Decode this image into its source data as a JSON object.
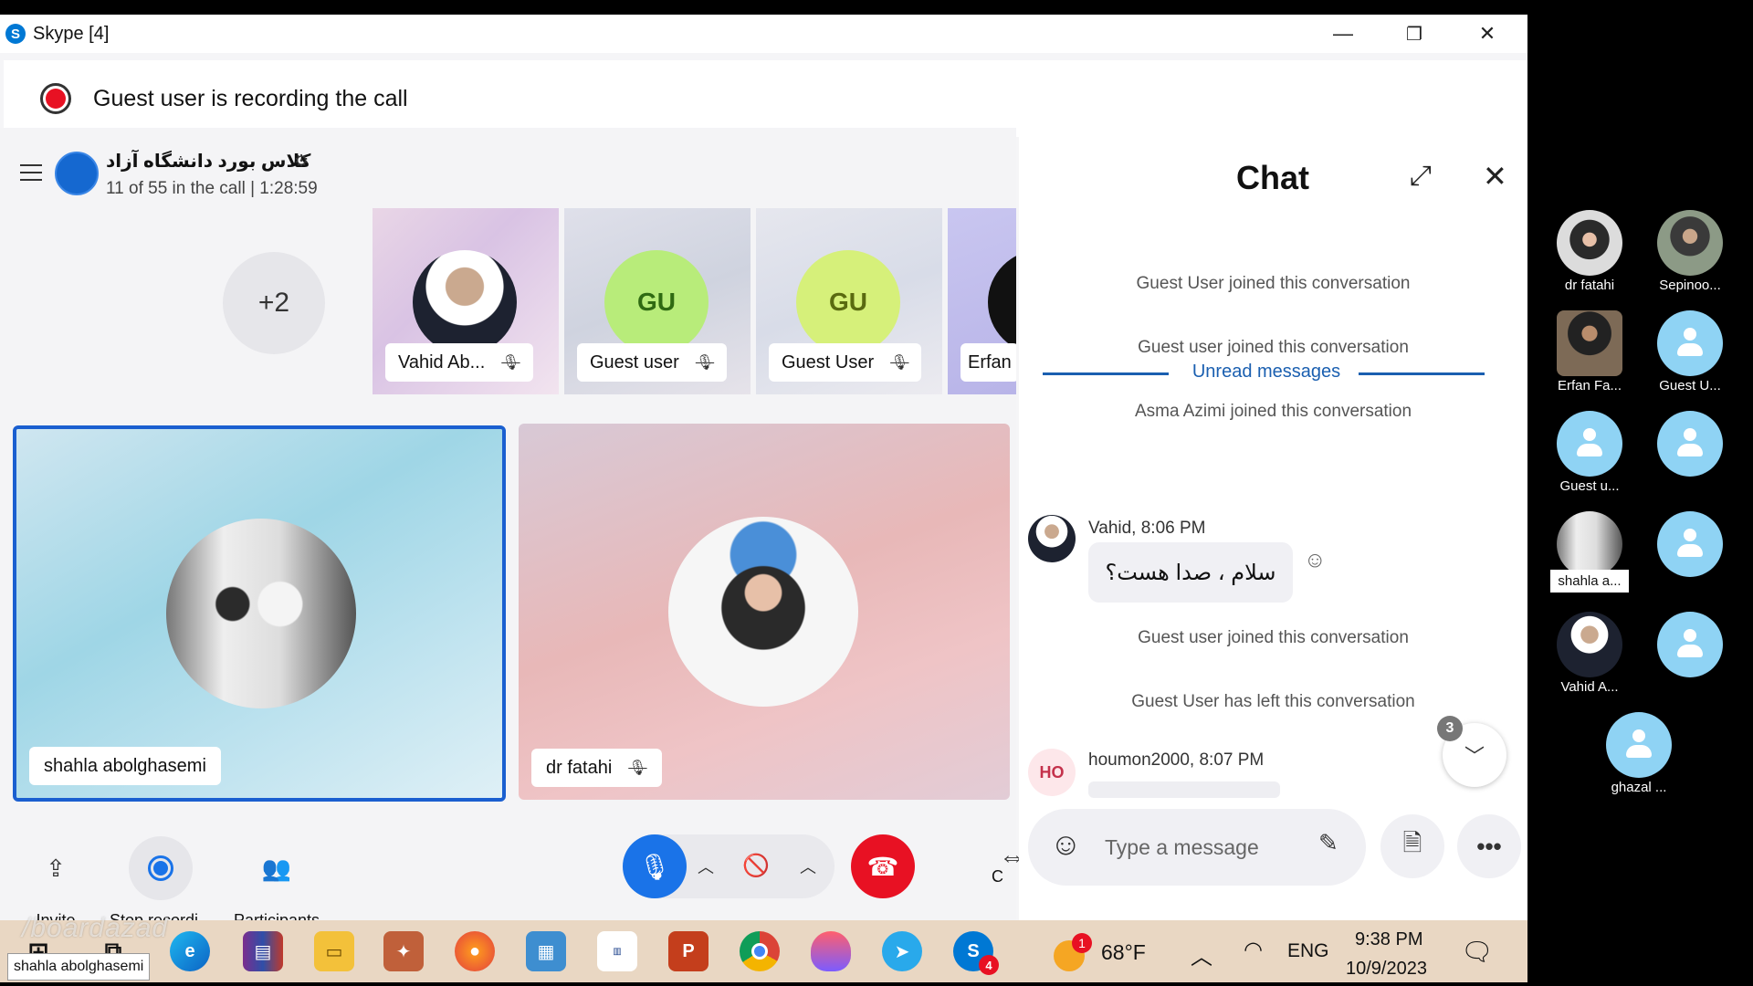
{
  "window": {
    "title": "Skype [4]",
    "app_logo": "S",
    "minimize_glyph": "—",
    "restore_glyph": "❐",
    "close_glyph": "✕"
  },
  "recording_banner": {
    "text": "Guest user is recording the call"
  },
  "call": {
    "group_name": "کلاس بورد دانشگاه آزاد",
    "status": "11 of 55 in the call | 1:28:59",
    "more_count": "+2",
    "participants_strip": [
      {
        "name": "Vahid Ab...",
        "initials": "",
        "muted": true
      },
      {
        "name": "Guest user",
        "initials": "GU",
        "muted": true
      },
      {
        "name": "Guest User",
        "initials": "GU",
        "muted": true
      },
      {
        "name": "Erfan",
        "initials": "",
        "muted": false
      }
    ],
    "main_tiles": [
      {
        "name": "shahla abolghasemi",
        "muted": false
      },
      {
        "name": "dr fatahi",
        "muted": true
      }
    ],
    "toolbar": {
      "invite_label": "Invite",
      "stop_recording_label": "Stop recordi...",
      "participants_label": "Participants",
      "partial_label": "C"
    }
  },
  "chat": {
    "title": "Chat",
    "system_messages": [
      "Guest User joined this conversation",
      "Guest user joined this conversation",
      "Asma Azimi joined this conversation"
    ],
    "unread_label": "Unread messages",
    "message_1": {
      "sender": "Vahid, 8:06 PM",
      "text": "سلام ، صدا هست؟"
    },
    "system_messages_2": [
      "Guest user joined this conversation",
      "Guest User has left this conversation"
    ],
    "message_2": {
      "sender": "houmon2000, 8:07 PM",
      "initials": "HO"
    },
    "scroll_badge": "3",
    "composer": {
      "placeholder": "Type a message"
    }
  },
  "taskbar": {
    "temperature": "68°F",
    "weather_badge": "1",
    "language": "ENG",
    "time": "9:38 PM",
    "date": "10/9/2023",
    "skype_badge": "4",
    "hover_label": "shahla abolghasemi",
    "icons": [
      "windows-start",
      "task-view",
      "edge",
      "winrar",
      "file-explorer",
      "app",
      "firefox",
      "control-panel",
      "app-library",
      "powerpoint",
      "chrome",
      "app-flame",
      "telegram",
      "skype"
    ]
  },
  "watermark": "/boardazad",
  "side_participants": [
    {
      "label": "dr fatahi"
    },
    {
      "label": "Sepinoo..."
    },
    {
      "label": "Erfan Fa..."
    },
    {
      "label": "Guest U..."
    },
    {
      "label": "Guest u..."
    },
    {
      "label": ""
    },
    {
      "label": "shahla a..."
    },
    {
      "label": ""
    },
    {
      "label": "Vahid A..."
    },
    {
      "label": ""
    },
    {
      "label": "ghazal ..."
    }
  ],
  "colors": {
    "accent": "#1a73e8",
    "hangup": "#e81123",
    "recording": "#e81123",
    "unread": "#1a5fb0",
    "taskbar": "#e9d7c3"
  }
}
